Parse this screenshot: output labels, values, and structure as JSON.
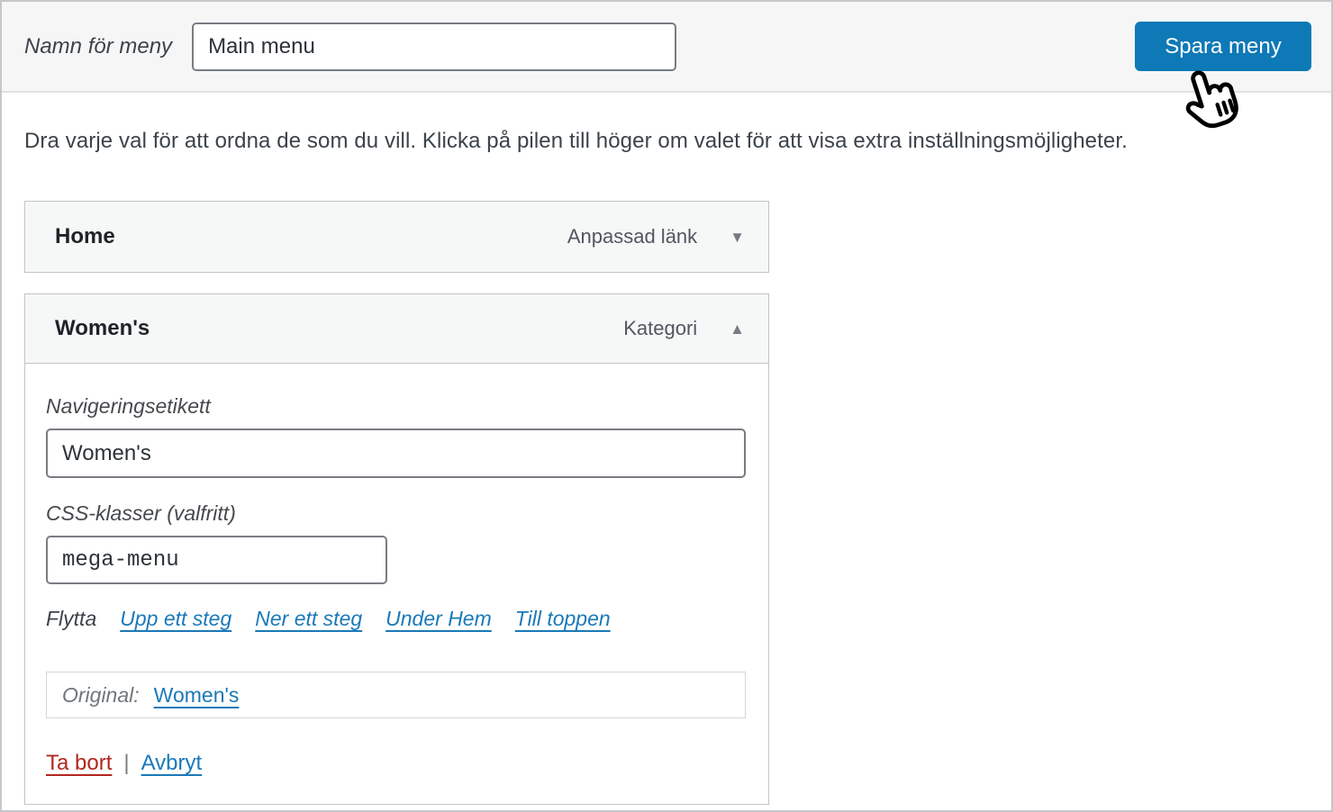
{
  "topbar": {
    "menu_name_label": "Namn för meny",
    "menu_name_value": "Main menu",
    "save_button": "Spara meny"
  },
  "instructions": "Dra varje val för att ordna de som du vill. Klicka på pilen till höger om valet för att visa extra inställningsmöjligheter.",
  "menu_items": [
    {
      "label": "Home",
      "type": "Anpassad länk",
      "state": "collapsed"
    },
    {
      "label": "Women's",
      "type": "Kategori",
      "state": "expanded"
    }
  ],
  "item_settings": {
    "nav_label": "Navigeringsetikett",
    "nav_label_value": "Women's",
    "css_classes_label": "CSS-klasser (valfritt)",
    "css_classes_value": "mega-menu",
    "move_label": "Flytta",
    "move_links": [
      "Upp ett steg",
      "Ner ett steg",
      "Under Hem",
      "Till toppen"
    ],
    "original_label": "Original:",
    "original_link": "Women's",
    "remove_link": "Ta bort",
    "separator": "|",
    "cancel_link": "Avbryt"
  },
  "icons": {
    "collapse_down": "▼",
    "collapse_up": "▲",
    "hand_cursor": "hand-pointer-cursor"
  },
  "colors": {
    "accent_blue": "#0d79b6",
    "link_blue": "#1a79b8",
    "danger_red": "#b1271f",
    "topbar_bg": "#f6f6f6",
    "item_bg": "#f6f7f7",
    "border_gray": "#c3c4c7"
  }
}
